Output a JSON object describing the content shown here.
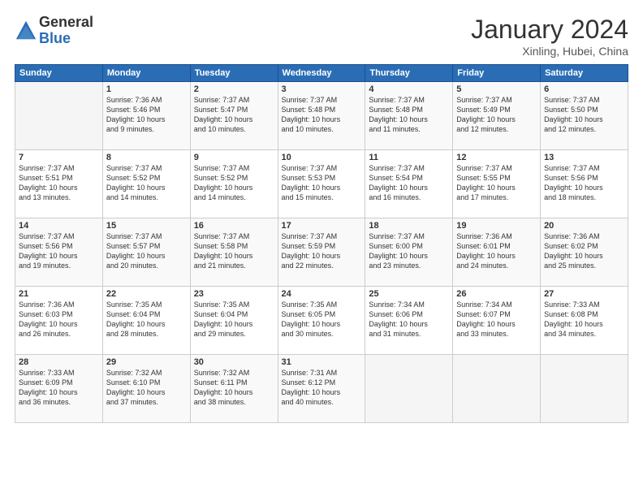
{
  "header": {
    "logo_general": "General",
    "logo_blue": "Blue",
    "title": "January 2024",
    "location": "Xinling, Hubei, China"
  },
  "days_of_week": [
    "Sunday",
    "Monday",
    "Tuesday",
    "Wednesday",
    "Thursday",
    "Friday",
    "Saturday"
  ],
  "weeks": [
    [
      {
        "day": "",
        "info": ""
      },
      {
        "day": "1",
        "info": "Sunrise: 7:36 AM\nSunset: 5:46 PM\nDaylight: 10 hours\nand 9 minutes."
      },
      {
        "day": "2",
        "info": "Sunrise: 7:37 AM\nSunset: 5:47 PM\nDaylight: 10 hours\nand 10 minutes."
      },
      {
        "day": "3",
        "info": "Sunrise: 7:37 AM\nSunset: 5:48 PM\nDaylight: 10 hours\nand 10 minutes."
      },
      {
        "day": "4",
        "info": "Sunrise: 7:37 AM\nSunset: 5:48 PM\nDaylight: 10 hours\nand 11 minutes."
      },
      {
        "day": "5",
        "info": "Sunrise: 7:37 AM\nSunset: 5:49 PM\nDaylight: 10 hours\nand 12 minutes."
      },
      {
        "day": "6",
        "info": "Sunrise: 7:37 AM\nSunset: 5:50 PM\nDaylight: 10 hours\nand 12 minutes."
      }
    ],
    [
      {
        "day": "7",
        "info": "Sunrise: 7:37 AM\nSunset: 5:51 PM\nDaylight: 10 hours\nand 13 minutes."
      },
      {
        "day": "8",
        "info": "Sunrise: 7:37 AM\nSunset: 5:52 PM\nDaylight: 10 hours\nand 14 minutes."
      },
      {
        "day": "9",
        "info": "Sunrise: 7:37 AM\nSunset: 5:52 PM\nDaylight: 10 hours\nand 14 minutes."
      },
      {
        "day": "10",
        "info": "Sunrise: 7:37 AM\nSunset: 5:53 PM\nDaylight: 10 hours\nand 15 minutes."
      },
      {
        "day": "11",
        "info": "Sunrise: 7:37 AM\nSunset: 5:54 PM\nDaylight: 10 hours\nand 16 minutes."
      },
      {
        "day": "12",
        "info": "Sunrise: 7:37 AM\nSunset: 5:55 PM\nDaylight: 10 hours\nand 17 minutes."
      },
      {
        "day": "13",
        "info": "Sunrise: 7:37 AM\nSunset: 5:56 PM\nDaylight: 10 hours\nand 18 minutes."
      }
    ],
    [
      {
        "day": "14",
        "info": "Sunrise: 7:37 AM\nSunset: 5:56 PM\nDaylight: 10 hours\nand 19 minutes."
      },
      {
        "day": "15",
        "info": "Sunrise: 7:37 AM\nSunset: 5:57 PM\nDaylight: 10 hours\nand 20 minutes."
      },
      {
        "day": "16",
        "info": "Sunrise: 7:37 AM\nSunset: 5:58 PM\nDaylight: 10 hours\nand 21 minutes."
      },
      {
        "day": "17",
        "info": "Sunrise: 7:37 AM\nSunset: 5:59 PM\nDaylight: 10 hours\nand 22 minutes."
      },
      {
        "day": "18",
        "info": "Sunrise: 7:37 AM\nSunset: 6:00 PM\nDaylight: 10 hours\nand 23 minutes."
      },
      {
        "day": "19",
        "info": "Sunrise: 7:36 AM\nSunset: 6:01 PM\nDaylight: 10 hours\nand 24 minutes."
      },
      {
        "day": "20",
        "info": "Sunrise: 7:36 AM\nSunset: 6:02 PM\nDaylight: 10 hours\nand 25 minutes."
      }
    ],
    [
      {
        "day": "21",
        "info": "Sunrise: 7:36 AM\nSunset: 6:03 PM\nDaylight: 10 hours\nand 26 minutes."
      },
      {
        "day": "22",
        "info": "Sunrise: 7:35 AM\nSunset: 6:04 PM\nDaylight: 10 hours\nand 28 minutes."
      },
      {
        "day": "23",
        "info": "Sunrise: 7:35 AM\nSunset: 6:04 PM\nDaylight: 10 hours\nand 29 minutes."
      },
      {
        "day": "24",
        "info": "Sunrise: 7:35 AM\nSunset: 6:05 PM\nDaylight: 10 hours\nand 30 minutes."
      },
      {
        "day": "25",
        "info": "Sunrise: 7:34 AM\nSunset: 6:06 PM\nDaylight: 10 hours\nand 31 minutes."
      },
      {
        "day": "26",
        "info": "Sunrise: 7:34 AM\nSunset: 6:07 PM\nDaylight: 10 hours\nand 33 minutes."
      },
      {
        "day": "27",
        "info": "Sunrise: 7:33 AM\nSunset: 6:08 PM\nDaylight: 10 hours\nand 34 minutes."
      }
    ],
    [
      {
        "day": "28",
        "info": "Sunrise: 7:33 AM\nSunset: 6:09 PM\nDaylight: 10 hours\nand 36 minutes."
      },
      {
        "day": "29",
        "info": "Sunrise: 7:32 AM\nSunset: 6:10 PM\nDaylight: 10 hours\nand 37 minutes."
      },
      {
        "day": "30",
        "info": "Sunrise: 7:32 AM\nSunset: 6:11 PM\nDaylight: 10 hours\nand 38 minutes."
      },
      {
        "day": "31",
        "info": "Sunrise: 7:31 AM\nSunset: 6:12 PM\nDaylight: 10 hours\nand 40 minutes."
      },
      {
        "day": "",
        "info": ""
      },
      {
        "day": "",
        "info": ""
      },
      {
        "day": "",
        "info": ""
      }
    ]
  ]
}
